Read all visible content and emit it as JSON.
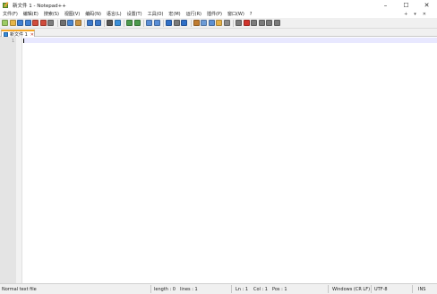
{
  "window": {
    "title": "新文件 1 - Notepad++",
    "minimize_glyph": "–",
    "maximize_glyph": "☐",
    "close_glyph": "✕"
  },
  "menu": {
    "items": [
      "文件(F)",
      "编辑(E)",
      "搜索(S)",
      "视图(V)",
      "编码(N)",
      "语言(L)",
      "设置(T)",
      "工具(O)",
      "宏(M)",
      "运行(R)",
      "插件(P)",
      "窗口(W)",
      "?"
    ],
    "right_glyphs": [
      "+",
      "▾",
      "✕"
    ]
  },
  "toolbar": {
    "buttons": [
      {
        "name": "new-file-icon",
        "color": "#9ccc65"
      },
      {
        "name": "open-file-icon",
        "color": "#e6b64a"
      },
      {
        "name": "save-icon",
        "color": "#3f7fd1"
      },
      {
        "name": "save-all-icon",
        "color": "#3f7fd1"
      },
      {
        "name": "close-icon",
        "color": "#d04b3b"
      },
      {
        "name": "close-all-icon",
        "color": "#d04b3b"
      },
      {
        "name": "print-icon",
        "color": "#7d7d7d"
      },
      {
        "sep": true
      },
      {
        "name": "cut-icon",
        "color": "#6e6e6e"
      },
      {
        "name": "copy-icon",
        "color": "#4a86cf"
      },
      {
        "name": "paste-icon",
        "color": "#c99545"
      },
      {
        "sep": true
      },
      {
        "name": "undo-icon",
        "color": "#3c78c8"
      },
      {
        "name": "redo-icon",
        "color": "#3c78c8"
      },
      {
        "sep": true
      },
      {
        "name": "find-icon",
        "color": "#555555"
      },
      {
        "name": "replace-icon",
        "color": "#3a8fd9"
      },
      {
        "sep": true
      },
      {
        "name": "zoom-in-icon",
        "color": "#4d9a4d"
      },
      {
        "name": "zoom-out-icon",
        "color": "#4d9a4d"
      },
      {
        "sep": true
      },
      {
        "name": "sync-vertical-icon",
        "color": "#5a8ed6"
      },
      {
        "name": "sync-horizontal-icon",
        "color": "#5a8ed6"
      },
      {
        "sep": true
      },
      {
        "name": "word-wrap-icon",
        "color": "#2f6fc7"
      },
      {
        "name": "show-all-chars-icon",
        "color": "#7a7a7a"
      },
      {
        "name": "indent-guide-icon",
        "color": "#2f6fc7"
      },
      {
        "sep": true
      },
      {
        "name": "udl-icon",
        "color": "#bf7b30"
      },
      {
        "name": "doc-map-icon",
        "color": "#6c9bd6"
      },
      {
        "name": "function-list-icon",
        "color": "#5c8fd1"
      },
      {
        "name": "folder-workspace-icon",
        "color": "#e4b04a"
      },
      {
        "name": "doc-switcher-icon",
        "color": "#8a8a8a"
      },
      {
        "sep": true
      },
      {
        "name": "monitor-icon",
        "color": "#7b7b7b"
      },
      {
        "name": "record-macro-icon",
        "color": "#d0342c"
      },
      {
        "name": "stop-macro-icon",
        "color": "#7b7b7b"
      },
      {
        "name": "play-macro-icon",
        "color": "#7b7b7b"
      },
      {
        "name": "run-macro-multiple-icon",
        "color": "#7b7b7b"
      },
      {
        "name": "save-macro-icon",
        "color": "#7b7b7b"
      }
    ]
  },
  "tab": {
    "label": "新文件 1",
    "close_glyph": "✕"
  },
  "editor": {
    "line_number": "1"
  },
  "statusbar": {
    "file_type": "Normal text file",
    "length": "length : 0",
    "lines": "lines : 1",
    "ln": "Ln : 1",
    "col": "Col : 1",
    "pos": "Pos : 1",
    "eol": "Windows (CR LF)",
    "encoding": "UTF-8",
    "mode": "INS"
  }
}
